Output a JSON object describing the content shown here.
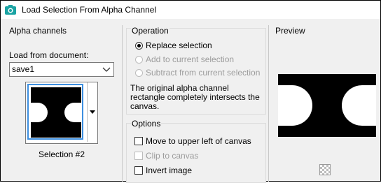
{
  "window": {
    "title": "Load Selection From Alpha Channel"
  },
  "alpha": {
    "heading": "Alpha channels",
    "load_label": "Load from document:",
    "document": "save1",
    "selection_caption": "Selection #2"
  },
  "operation": {
    "heading": "Operation",
    "options": [
      {
        "label": "Replace selection",
        "checked": true,
        "enabled": true
      },
      {
        "label": "Add to current selection",
        "checked": false,
        "enabled": false
      },
      {
        "label": "Subtract from current selection",
        "checked": false,
        "enabled": false
      }
    ],
    "info": "The original alpha channel rectangle completely intersects the canvas."
  },
  "options": {
    "heading": "Options",
    "items": [
      {
        "label": "Move to upper left of canvas",
        "checked": false,
        "enabled": true
      },
      {
        "label": "Clip to canvas",
        "checked": false,
        "enabled": false
      },
      {
        "label": "Invert image",
        "checked": false,
        "enabled": true
      }
    ]
  },
  "preview": {
    "heading": "Preview"
  },
  "colors": {
    "accent": "#3d8fe0",
    "app_icon": "#1aa3a3"
  }
}
